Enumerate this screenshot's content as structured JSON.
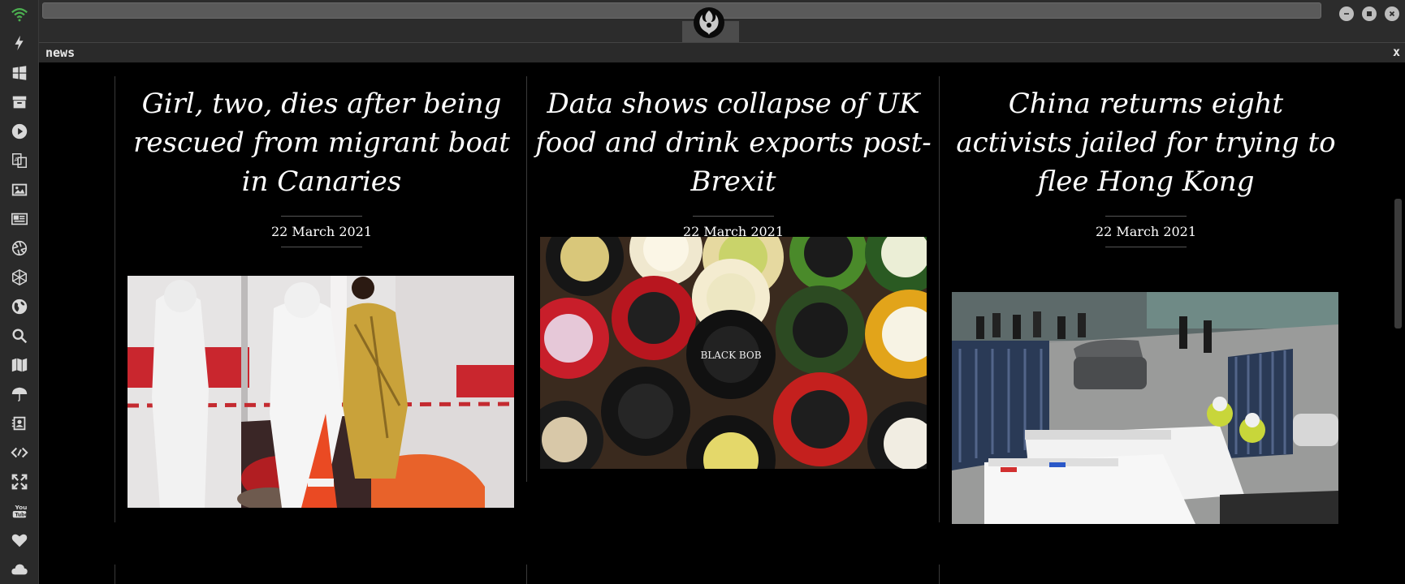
{
  "window": {
    "panel_title": "news",
    "panel_close": "x"
  },
  "sidebar": {
    "items": [
      {
        "icon": "wifi-icon",
        "color": "#4caf50"
      },
      {
        "icon": "lightning-icon"
      },
      {
        "icon": "windows-icon"
      },
      {
        "icon": "archive-icon"
      },
      {
        "icon": "play-icon"
      },
      {
        "icon": "translate-icon"
      },
      {
        "icon": "image-icon"
      },
      {
        "icon": "newspaper-icon"
      },
      {
        "icon": "aperture-icon"
      },
      {
        "icon": "hexagon-icon"
      },
      {
        "icon": "globe-icon"
      },
      {
        "icon": "search-icon"
      },
      {
        "icon": "map-icon"
      },
      {
        "icon": "umbrella-icon"
      },
      {
        "icon": "contacts-icon"
      },
      {
        "icon": "code-icon"
      },
      {
        "icon": "expand-icon"
      },
      {
        "icon": "youtube-icon"
      },
      {
        "icon": "heart-icon"
      },
      {
        "icon": "cloud-icon"
      }
    ]
  },
  "articles": [
    {
      "headline": "Girl, two, dies after being rescued from migrant boat in Canaries",
      "date": "22 March 2021",
      "image": "rescue-workers-photo"
    },
    {
      "headline": "Data shows collapse of UK food and drink exports post-Brexit",
      "date": "22 March 2021",
      "image": "cheese-wheels-photo"
    },
    {
      "headline": "China returns eight activists jailed for trying to flee Hong Kong",
      "date": "22 March 2021",
      "image": "police-vans-photo"
    }
  ],
  "colors": {
    "background": "#000000",
    "chrome": "#2a2a2a",
    "text": "#ffffff",
    "wifi_active": "#4caf50"
  }
}
